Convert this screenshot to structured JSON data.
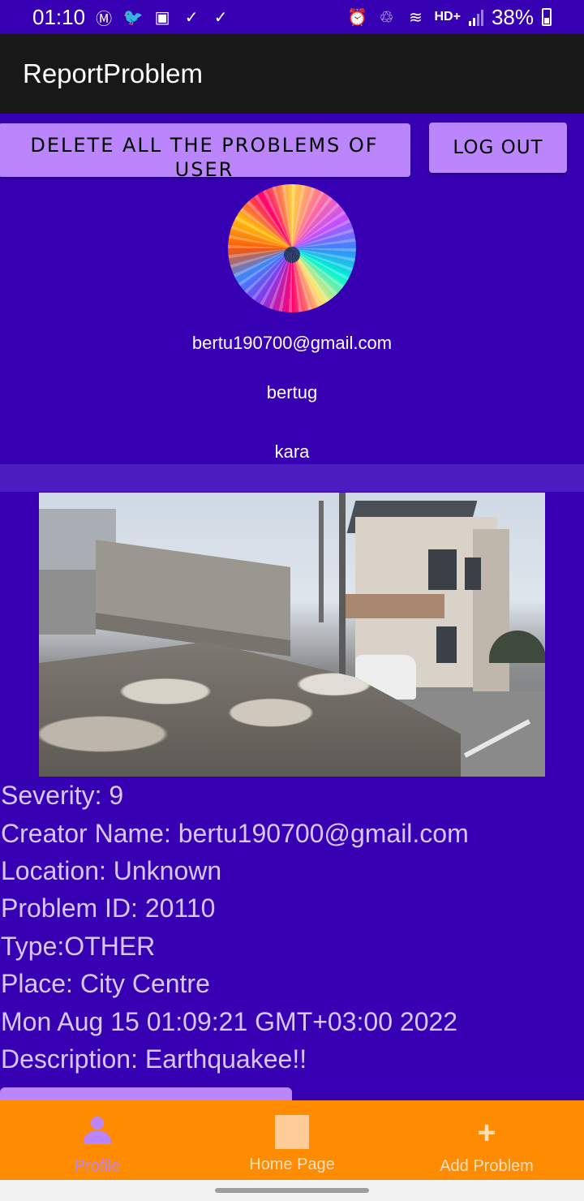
{
  "status_bar": {
    "time": "01:10",
    "network_label": "HD+",
    "battery_percent": "38%",
    "left_icons": [
      "m-circle-icon",
      "twitter-icon",
      "image-icon",
      "check-icon",
      "check-icon"
    ],
    "right_icons": [
      "alarm-icon",
      "recycle-icon",
      "wifi-icon",
      "signal-icon",
      "battery-icon"
    ]
  },
  "app_bar": {
    "title": "ReportProblem"
  },
  "actions": {
    "delete_all_label": "DELETE ALL THE PROBLEMS OF USER",
    "logout_label": "LOG OUT"
  },
  "profile": {
    "email": "bertu190700@gmail.com",
    "first_name": "bertug",
    "last_name": "kara"
  },
  "problem": {
    "severity": "Severity: 9",
    "creator": "Creator Name: bertu190700@gmail.com",
    "location": "Location: Unknown",
    "problem_id": "Problem ID: 20110",
    "type": "Type:OTHER",
    "place": "Place: City Centre",
    "date": "Mon Aug 15 01:09:21 GMT+03:00 2022",
    "description": "Description: Earthquakee!!"
  },
  "bottom_nav": {
    "items": [
      {
        "label": "Profile",
        "icon": "person-icon",
        "active": true
      },
      {
        "label": "Home Page",
        "icon": "home-icon",
        "active": false
      },
      {
        "label": "Add Problem",
        "icon": "plus-icon",
        "active": false
      }
    ]
  },
  "colors": {
    "background": "#3700B3",
    "app_bar": "#181818",
    "button": "#BB86FC",
    "detail_text": "#D9C6FF",
    "bottom_nav": "#FF8C00"
  }
}
